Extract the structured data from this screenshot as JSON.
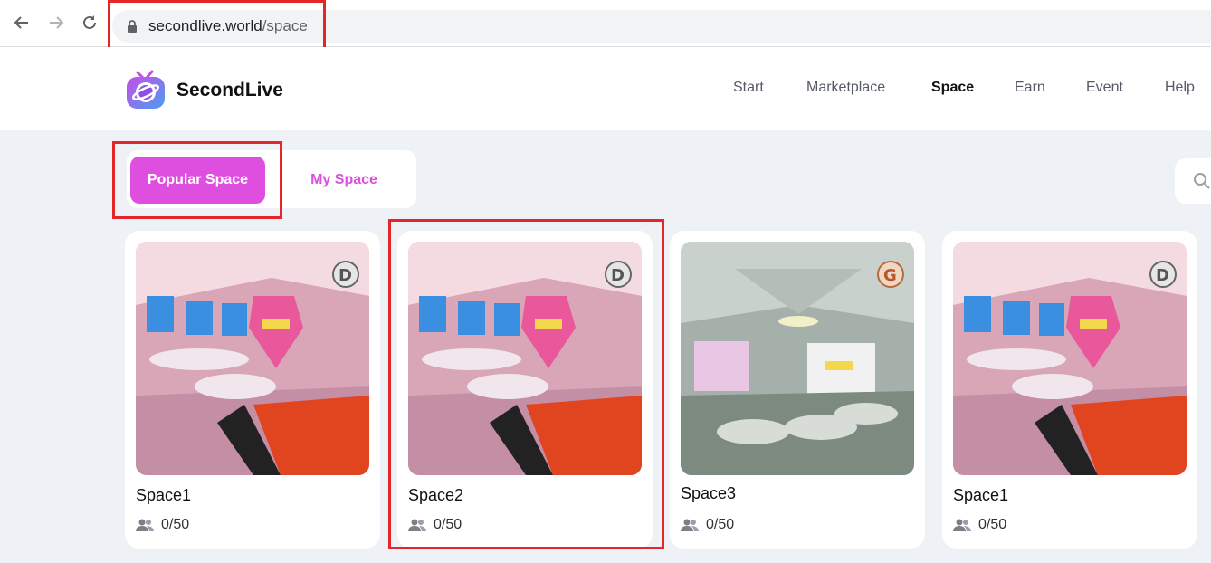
{
  "browser": {
    "url_host": "secondlive.world",
    "url_path": "/space"
  },
  "header": {
    "logo_text": "SecondLive",
    "nav": [
      {
        "label": "Start"
      },
      {
        "label": "Marketplace"
      },
      {
        "label": "Space",
        "active": true
      },
      {
        "label": "Earn"
      },
      {
        "label": "Event"
      },
      {
        "label": "Help"
      }
    ]
  },
  "tabs": {
    "popular": "Popular Space",
    "my": "My Space"
  },
  "cards": [
    {
      "title": "Space1",
      "count": "0/50",
      "badge": "D"
    },
    {
      "title": "Space2",
      "count": "0/50",
      "badge": "D"
    },
    {
      "title": "Space3",
      "count": "0/50",
      "badge": "G"
    },
    {
      "title": "Space1",
      "count": "0/50",
      "badge": "D"
    }
  ],
  "colors": {
    "accent": "#de4fe0",
    "highlight": "#e3262a"
  }
}
